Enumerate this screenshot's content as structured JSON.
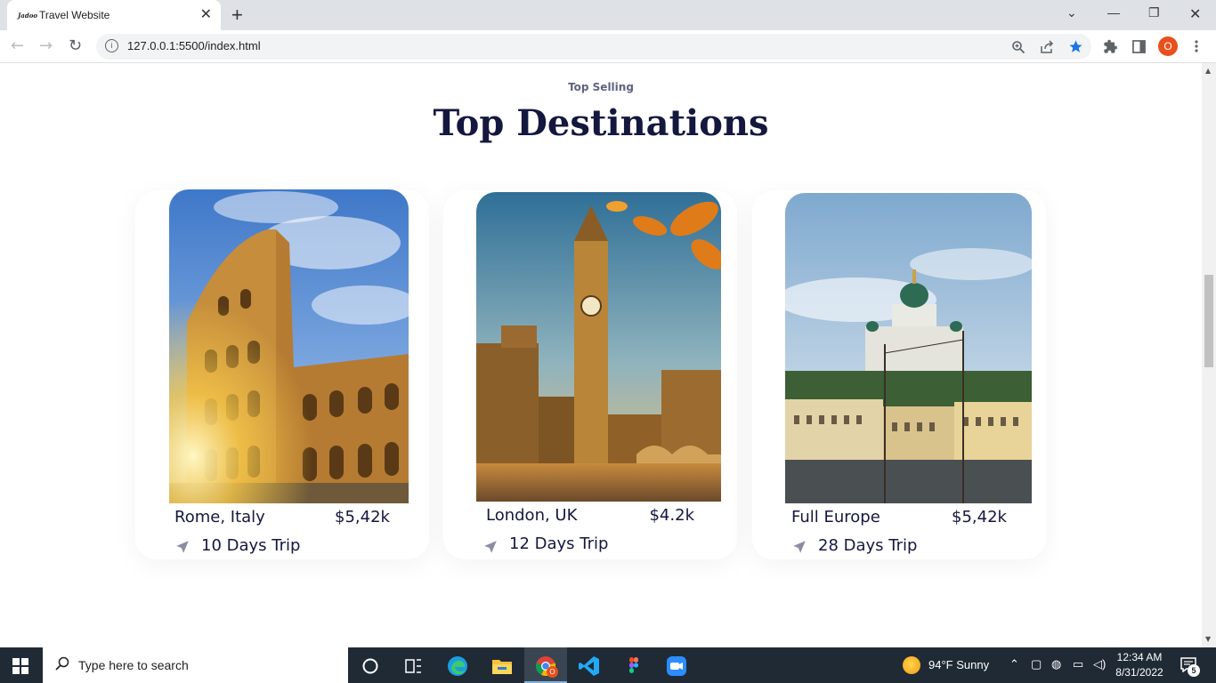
{
  "browser": {
    "tab_title": "Travel Website",
    "tab_favicon": "Jadoo",
    "url": "127.0.0.1:5500/index.html",
    "profile_initial": "O",
    "icons": [
      "back-icon",
      "forward-icon",
      "reload-icon",
      "info-icon",
      "zoom-icon",
      "share-icon",
      "bookmark-star-icon",
      "extensions-icon",
      "side-panel-icon",
      "menu-icon"
    ]
  },
  "section": {
    "kicker": "Top Selling",
    "title": "Top Destinations"
  },
  "destinations": [
    {
      "name": "Rome, Italy",
      "price": "$5,42k",
      "trip": "10 Days Trip"
    },
    {
      "name": "London, UK",
      "price": "$4.2k",
      "trip": "12 Days Trip"
    },
    {
      "name": "Full Europe",
      "price": "$5,42k",
      "trip": "28 Days Trip"
    }
  ],
  "taskbar": {
    "search_placeholder": "Type here to search",
    "weather": "94°F  Sunny",
    "time": "12:34 AM",
    "date": "8/31/2022",
    "notification_count": "5",
    "chrome_badge": "O"
  },
  "colors": {
    "title": "#14183e",
    "kicker": "#5e6282",
    "taskbar": "#202a35",
    "profile": "#e8501c",
    "star": "#1a73e8"
  }
}
